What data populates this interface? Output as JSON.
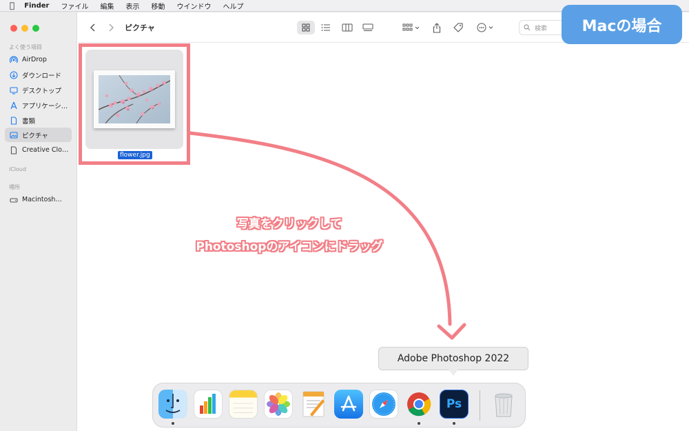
{
  "menubar": {
    "apple_icon": "apple-logo",
    "app_name": "Finder",
    "menus": [
      "ファイル",
      "編集",
      "表示",
      "移動",
      "ウインドウ",
      "ヘルプ"
    ]
  },
  "sidebar": {
    "favorites_heading": "よく使う項目",
    "items": [
      {
        "label": "AirDrop",
        "icon": "airdrop-icon"
      },
      {
        "label": "ダウンロード",
        "icon": "download-icon"
      },
      {
        "label": "デスクトップ",
        "icon": "desktop-icon"
      },
      {
        "label": "アプリケーシ…",
        "icon": "applications-icon"
      },
      {
        "label": "書類",
        "icon": "document-icon"
      },
      {
        "label": "ピクチャ",
        "icon": "pictures-icon",
        "selected": true
      },
      {
        "label": "Creative Clo…",
        "icon": "file-icon"
      }
    ],
    "icloud_heading": "iCloud",
    "locations_heading": "場所",
    "locations": [
      {
        "label": "Macintosh…",
        "icon": "disk-icon"
      }
    ]
  },
  "toolbar": {
    "title": "ピクチャ",
    "search_placeholder": "検索"
  },
  "file": {
    "name": "flower.jpg"
  },
  "annotation": {
    "line1": "写真をクリックして",
    "line2": "Photoshopのアイコンにドラッグ",
    "badge": "Macの場合",
    "accent_color": "#f27f87",
    "badge_color": "#5ba0e6"
  },
  "tooltip": {
    "text": "Adobe Photoshop 2022"
  },
  "dock": {
    "apps": [
      {
        "name": "finder-icon",
        "running": true
      },
      {
        "name": "numbers-icon",
        "running": false
      },
      {
        "name": "notes-icon",
        "running": false
      },
      {
        "name": "photos-icon",
        "running": false
      },
      {
        "name": "pages-icon",
        "running": false
      },
      {
        "name": "app-store-icon",
        "running": false
      },
      {
        "name": "safari-icon",
        "running": false
      },
      {
        "name": "chrome-icon",
        "running": true
      },
      {
        "name": "photoshop-icon",
        "running": true
      },
      {
        "name": "trash-icon",
        "running": false
      }
    ],
    "photoshop_label": "Ps"
  }
}
